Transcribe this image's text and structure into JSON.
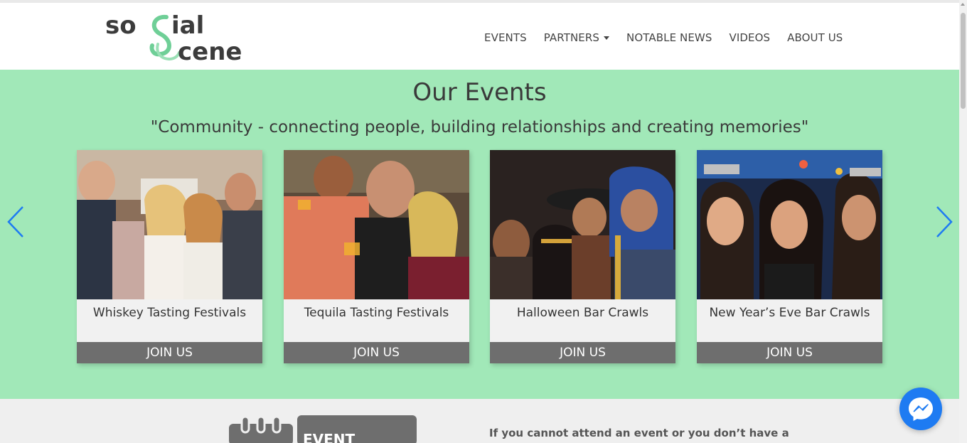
{
  "brand": {
    "logo_line1": "so   ial",
    "logo_line2": "cene"
  },
  "nav": {
    "items": [
      "EVENTS",
      "PARTNERS",
      "NOTABLE NEWS",
      "VIDEOS",
      "ABOUT US"
    ]
  },
  "events": {
    "heading": "Our Events",
    "tagline": "\"Community - connecting people, building relationships and creating memories\"",
    "cards": [
      {
        "title": "Whiskey Tasting Festivals",
        "button": "JOIN US"
      },
      {
        "title": "Tequila Tasting Festivals",
        "button": "JOIN US"
      },
      {
        "title": "Halloween Bar Crawls",
        "button": "JOIN US"
      },
      {
        "title": "New Year’s Eve Bar Crawls",
        "button": "JOIN US"
      }
    ]
  },
  "lower": {
    "calendar_label": "EVENT",
    "text": "If you cannot attend an event or you don’t have a"
  },
  "colors": {
    "events_bg": "#a1e8b8",
    "join_bg": "#6e6e6e",
    "arrow": "#1e7bf2",
    "messenger": "#1e7bf2"
  }
}
